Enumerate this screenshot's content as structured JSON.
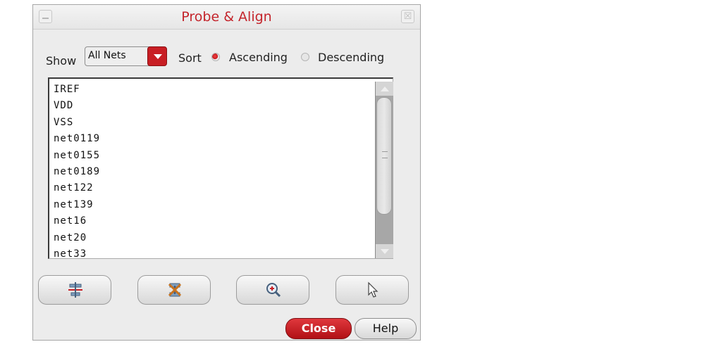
{
  "window": {
    "title": "Probe & Align",
    "close_glyph": "☒"
  },
  "filter": {
    "show_label": "Show",
    "show_value": "All Nets",
    "sort_label": "Sort",
    "ascending_label": "Ascending",
    "descending_label": "Descending",
    "selected_sort": "Ascending"
  },
  "nets": [
    "IREF",
    "VDD",
    "VSS",
    "net0119",
    "net0155",
    "net0189",
    "net122",
    "net139",
    "net16",
    "net20",
    "net33"
  ],
  "toolbar": {
    "icons": [
      "align-icon",
      "delete-probe-icon",
      "zoom-icon",
      "select-pointer-icon"
    ]
  },
  "footer": {
    "close_label": "Close",
    "help_label": "Help"
  },
  "colors": {
    "accent": "#c81e24",
    "title_text": "#c4252c"
  }
}
